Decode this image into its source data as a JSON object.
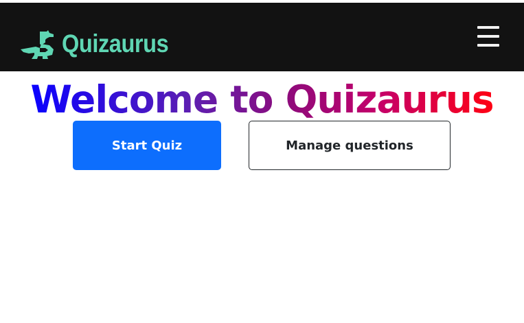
{
  "app": {
    "name": "Quizaurus",
    "brand_color": "#5fd6b3",
    "navbar_color": "#121212",
    "logo_icon": "dinosaur-icon",
    "menu_icon": "hamburger-menu-icon"
  },
  "hero": {
    "title": "Welcome to Quizaurus",
    "gradient_start": "#0a00ff",
    "gradient_end": "#ff0012"
  },
  "actions": {
    "start_quiz_label": "Start Quiz",
    "manage_questions_label": "Manage questions",
    "primary_color": "#0d6efd"
  }
}
